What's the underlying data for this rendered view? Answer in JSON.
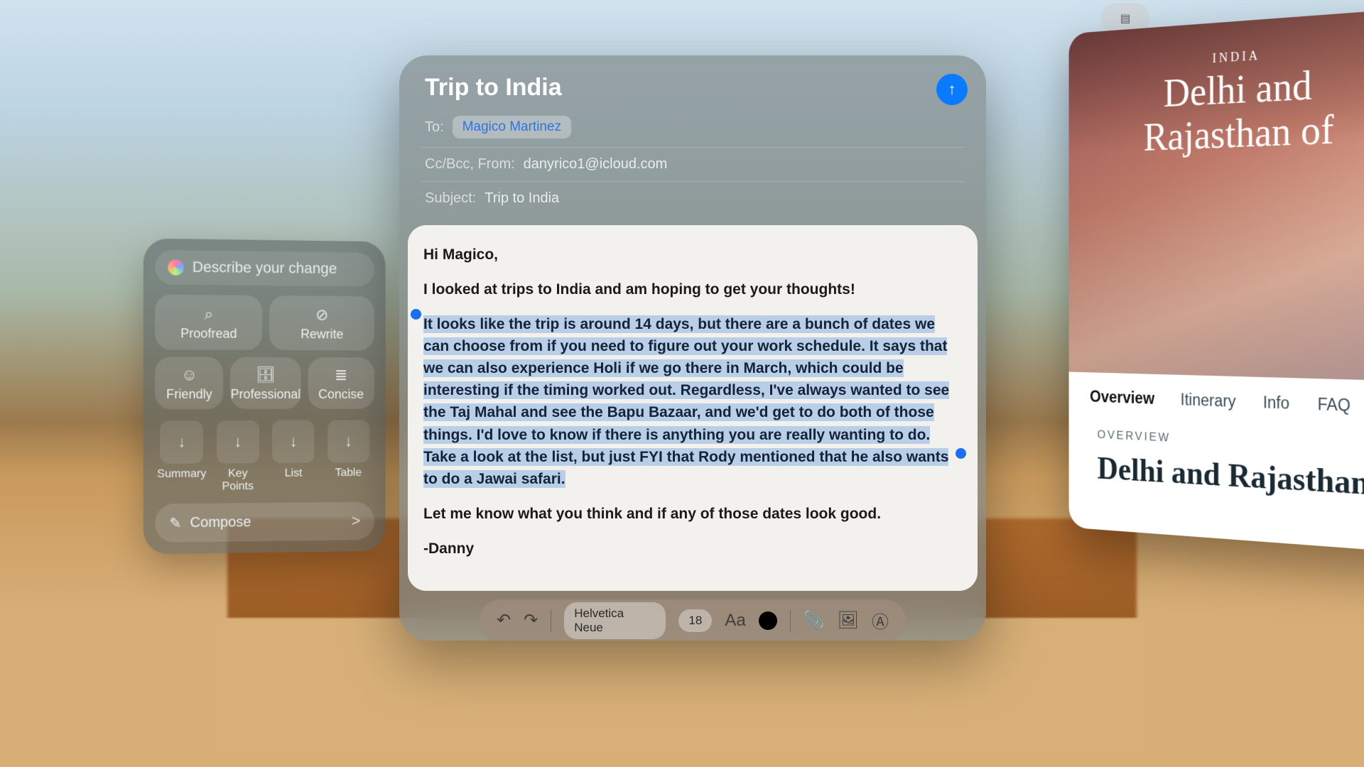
{
  "tools": {
    "describe_placeholder": "Describe your change",
    "proofread": "Proofread",
    "rewrite": "Rewrite",
    "friendly": "Friendly",
    "professional": "Professional",
    "concise": "Concise",
    "summary": "Summary",
    "keypoints": "Key Points",
    "list": "List",
    "table": "Table",
    "compose": "Compose"
  },
  "mail": {
    "title": "Trip to India",
    "to_label": "To:",
    "to_chip": "Magico Martinez",
    "cc_label": "Cc/Bcc, From:",
    "from_value": "danyrico1@icloud.com",
    "subject_label": "Subject:",
    "subject_value": "Trip to India",
    "body": {
      "greeting": "Hi Magico,",
      "p1": "I looked at trips to India and am hoping to get your thoughts!",
      "p2": "It looks like the trip is around 14 days, but there are a bunch of dates we can choose from if you need to figure out your work schedule. It says that we can also experience Holi if we go there in March, which could be interesting if the timing worked out. Regardless, I've always wanted to see the Taj Mahal and see the Bapu Bazaar, and we'd get to do both of those things.  I'd love to know if there is anything you are really wanting to do. Take a look at the list, but just FYI that Rody mentioned that he also wants to do a Jawai safari.",
      "p3": "Let me know what you think and if any of those dates look good.",
      "sig": "-Danny"
    },
    "toolbar": {
      "font": "Helvetica Neue",
      "size": "18"
    }
  },
  "browser": {
    "crumb": "INDIA",
    "hero_title": "Delhi and Rajasthan of",
    "tabs": {
      "overview": "Overview",
      "itinerary": "Itinerary",
      "info": "Info",
      "faq": "FAQ"
    },
    "overview_label": "OVERVIEW",
    "article_title": "Delhi and Rajasthan"
  },
  "icons": {
    "search": "⌕",
    "rewrite": "⊘",
    "smile": "☺",
    "briefcase": "🗄",
    "concise": "≣",
    "down": "↓",
    "pencil": "✎",
    "chevron": ">",
    "up": "↑",
    "undo": "↶",
    "redo": "↷",
    "aa": "Aa",
    "clip": "📎",
    "image": "🖼",
    "markup": "Ⓐ",
    "sidebar": "▤"
  }
}
